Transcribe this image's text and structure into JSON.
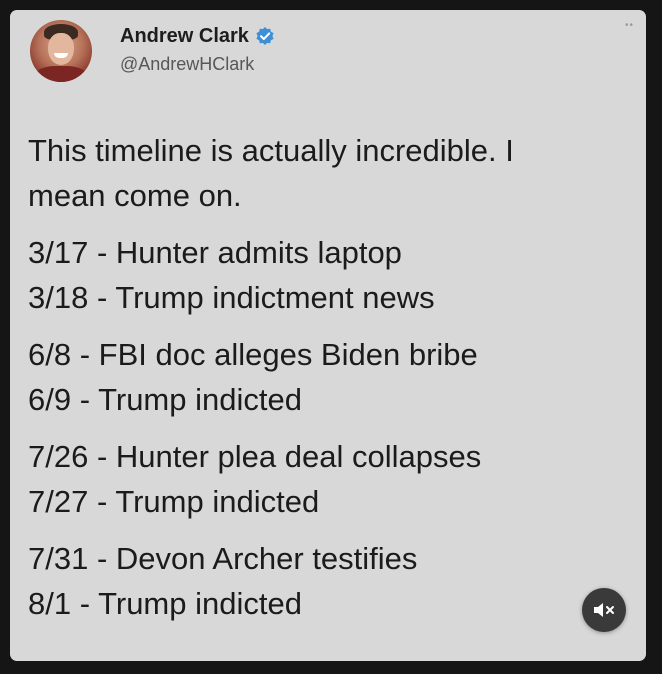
{
  "tweet": {
    "author": {
      "display_name": "Andrew Clark",
      "handle": "@AndrewHClark",
      "verified": true
    },
    "intro": [
      "This timeline is actually incredible. I",
      "mean come on."
    ],
    "groups": [
      [
        "3/17 - Hunter admits laptop",
        "3/18 - Trump indictment news"
      ],
      [
        "6/8 - FBI doc alleges Biden bribe",
        "6/9 - Trump indicted"
      ],
      [
        "7/26 - Hunter plea deal collapses",
        "7/27 - Trump indicted"
      ],
      [
        "7/31 - Devon Archer testifies",
        "8/1 - Trump indicted"
      ]
    ]
  },
  "icons": {
    "verified": "verified-badge-icon",
    "more": "more-options-icon",
    "mute": "muted-speaker-icon"
  },
  "colors": {
    "card_bg": "#d8d8d8",
    "page_bg": "#151515",
    "verified_blue": "#3d8fd6",
    "text": "#1b1b1b",
    "handle_text": "#575757"
  }
}
